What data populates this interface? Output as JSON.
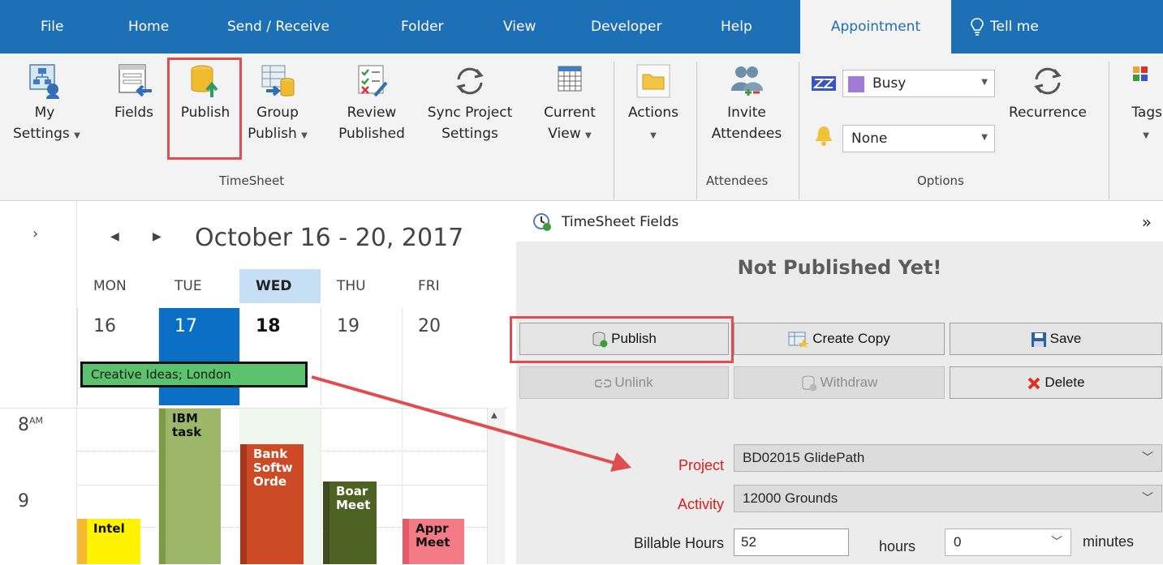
{
  "tabs": {
    "file": "File",
    "home": "Home",
    "send_receive": "Send / Receive",
    "folder": "Folder",
    "view": "View",
    "developer": "Developer",
    "help": "Help",
    "appointment": "Appointment",
    "tell_me": "Tell me"
  },
  "ribbon": {
    "my_settings_1": "My",
    "my_settings_2": "Settings",
    "fields": "Fields",
    "publish": "Publish",
    "group_publish_1": "Group",
    "group_publish_2": "Publish",
    "review_published_1": "Review",
    "review_published_2": "Published",
    "sync_1": "Sync Project",
    "sync_2": "Settings",
    "current_view_1": "Current",
    "current_view_2": "View",
    "actions": "Actions",
    "invite_1": "Invite",
    "invite_2": "Attendees",
    "show_as": "Busy",
    "reminder": "None",
    "recurrence": "Recurrence",
    "tags": "Tags",
    "group_timesheet": "TimeSheet",
    "group_attendees": "Attendees",
    "group_options": "Options"
  },
  "calendar": {
    "title": "October 16 - 20, 2017",
    "days": [
      {
        "name": "MON",
        "num": "16"
      },
      {
        "name": "TUE",
        "num": "17"
      },
      {
        "name": "WED",
        "num": "18"
      },
      {
        "name": "THU",
        "num": "19"
      },
      {
        "name": "FRI",
        "num": "20"
      }
    ],
    "allday_event": "Creative Ideas; London",
    "hour_8": "8",
    "hour_8_suffix": "AM",
    "hour_9": "9",
    "appointments": {
      "ibm": "IBM task",
      "bank": "Bank Softw Orde",
      "board": "Boar Meet",
      "intel": "Intel",
      "appr": "Appr Meet"
    }
  },
  "panel": {
    "title": "TimeSheet Fields",
    "status": "Not Published Yet!",
    "buttons": {
      "publish": "Publish",
      "create_copy": "Create Copy",
      "save": "Save",
      "unlink": "Unlink",
      "withdraw": "Withdraw",
      "delete": "Delete"
    },
    "fields": {
      "project_label": "Project",
      "project_value": "BD02015 GlidePath",
      "activity_label": "Activity",
      "activity_value": "12000  Grounds",
      "billable_label": "Billable Hours",
      "hours_value": "52",
      "hours_unit": "hours",
      "minutes_value": "0",
      "minutes_unit": "minutes"
    }
  },
  "colors": {
    "tabbar": "#1d6fb6",
    "highlight": "#e14c4c",
    "required_label": "#e01b1b",
    "today_column": "#0b6fc6"
  }
}
